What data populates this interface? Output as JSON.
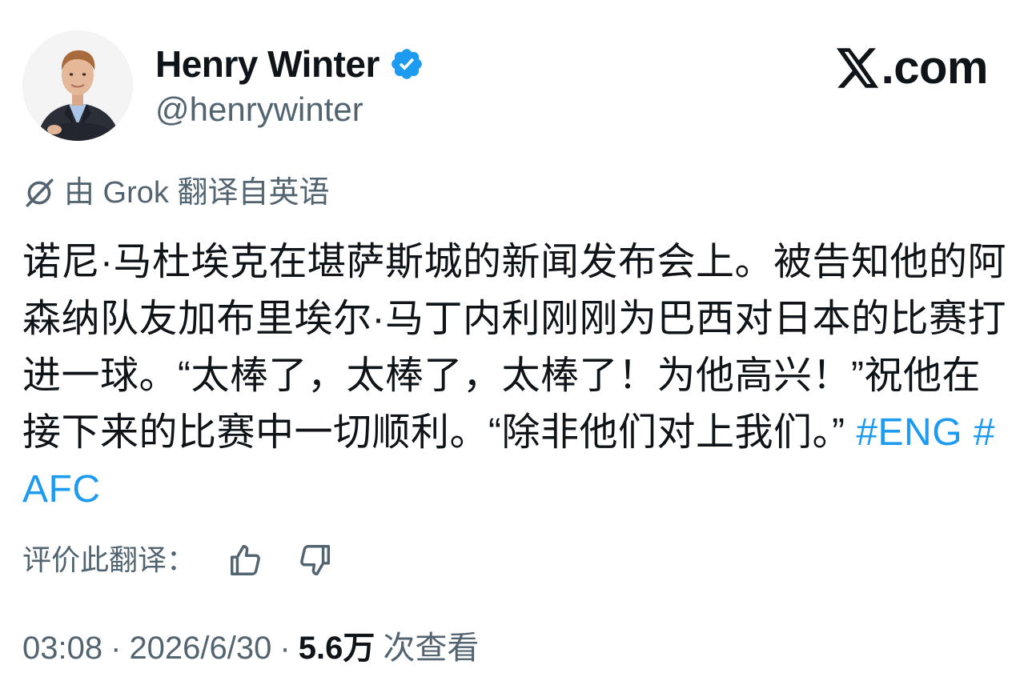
{
  "author": {
    "display_name": "Henry Winter",
    "handle": "@henrywinter",
    "verified": true,
    "verified_color": "#1d9bf0"
  },
  "brand": {
    "text": ".com",
    "icon": "x-logo-icon"
  },
  "translation": {
    "icon": "grok-icon",
    "notice": "由 Grok 翻译自英语"
  },
  "tweet": {
    "text": "诺尼·马杜埃克在堪萨斯城的新闻发布会上。被告知他的阿森纳队友加布里埃尔·马丁内利刚刚为巴西对日本的比赛打进一球。“太棒了，太棒了，太棒了！为他高兴！”祝他在接下来的比赛中一切顺利。“除非他们对上我们。” ",
    "hashtags": [
      "#ENG",
      "#AFC"
    ],
    "hashtag_color": "#1d9bf0"
  },
  "rate": {
    "label": "评价此翻译：",
    "thumbs_up_icon": "thumbs-up-icon",
    "thumbs_down_icon": "thumbs-down-icon"
  },
  "meta": {
    "time": "03:08",
    "separator": "·",
    "date": "2026/6/30",
    "views_count": "5.6万",
    "views_label": "次查看"
  }
}
